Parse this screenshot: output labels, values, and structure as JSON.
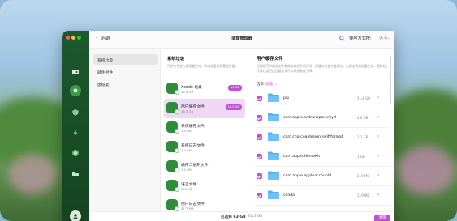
{
  "colors": {
    "accent": "#c34fd6",
    "sidebar_green": "#1d5a2e",
    "folder_blue": "#55b0f2"
  },
  "titlebar": {
    "back_label": "后退",
    "title": "清理管理器",
    "sort_label": "排序方式按:",
    "sort_value": "大小"
  },
  "sidebar": {
    "icons": [
      "disk-icon",
      "cleanup-icon",
      "protection-icon",
      "speed-icon",
      "apps-icon",
      "files-icon",
      "account-icon"
    ]
  },
  "categories": [
    {
      "label": "系统垃圾"
    },
    {
      "label": "邮件附件"
    },
    {
      "label": "废纸篓"
    }
  ],
  "subcategory": {
    "heading": "系统垃圾",
    "description": "冗余文件会占用磁盘空间，影响设备发挥最佳性能。",
    "items": [
      {
        "name": "Xcode 垃圾",
        "size": "22,4 GB",
        "pill": "12 GB"
      },
      {
        "name": "用户缓存文件",
        "size": "18,5 GB",
        "pill": "18,5 GB"
      },
      {
        "name": "系统缓存文件",
        "size": "3,4 GB",
        "pill": ""
      },
      {
        "name": "系统日志文件",
        "size": "3,4 GB",
        "pill": ""
      },
      {
        "name": "通用二进制文件",
        "size": "1,1 GB",
        "pill": ""
      },
      {
        "name": "语言文件",
        "size": "240 MB",
        "pill": ""
      },
      {
        "name": "用户日志文件",
        "size": "37,7 MB",
        "pill": ""
      }
    ]
  },
  "main": {
    "heading": "用户缓存文件",
    "description": "应用程序的缓存文件就用来缩短开机时间，但缓存也会大量增长，占用宝贵的磁盘空间。删除后，可放心运行这些缓存文件以降低磁盘下降。",
    "select_label": "选择:",
    "select_value": "智能",
    "files": [
      {
        "name": "pip",
        "size": "11,8 GB"
      },
      {
        "name": "com.apple.swtransparencyd",
        "size": "2,6 GB"
      },
      {
        "name": "com.charcoaldesign.swiftformat",
        "size": "1,1 GB"
      },
      {
        "name": "com.apple.HomeKit",
        "size": "1 GB"
      },
      {
        "name": "com.apple.appleaccountd",
        "size": "219 MB"
      },
      {
        "name": "conda",
        "size": "219 MB"
      }
    ]
  },
  "bottombar": {
    "selected_label": "已选择 63 GB",
    "total_label": "31,5 GB",
    "clean_button": "清理"
  }
}
